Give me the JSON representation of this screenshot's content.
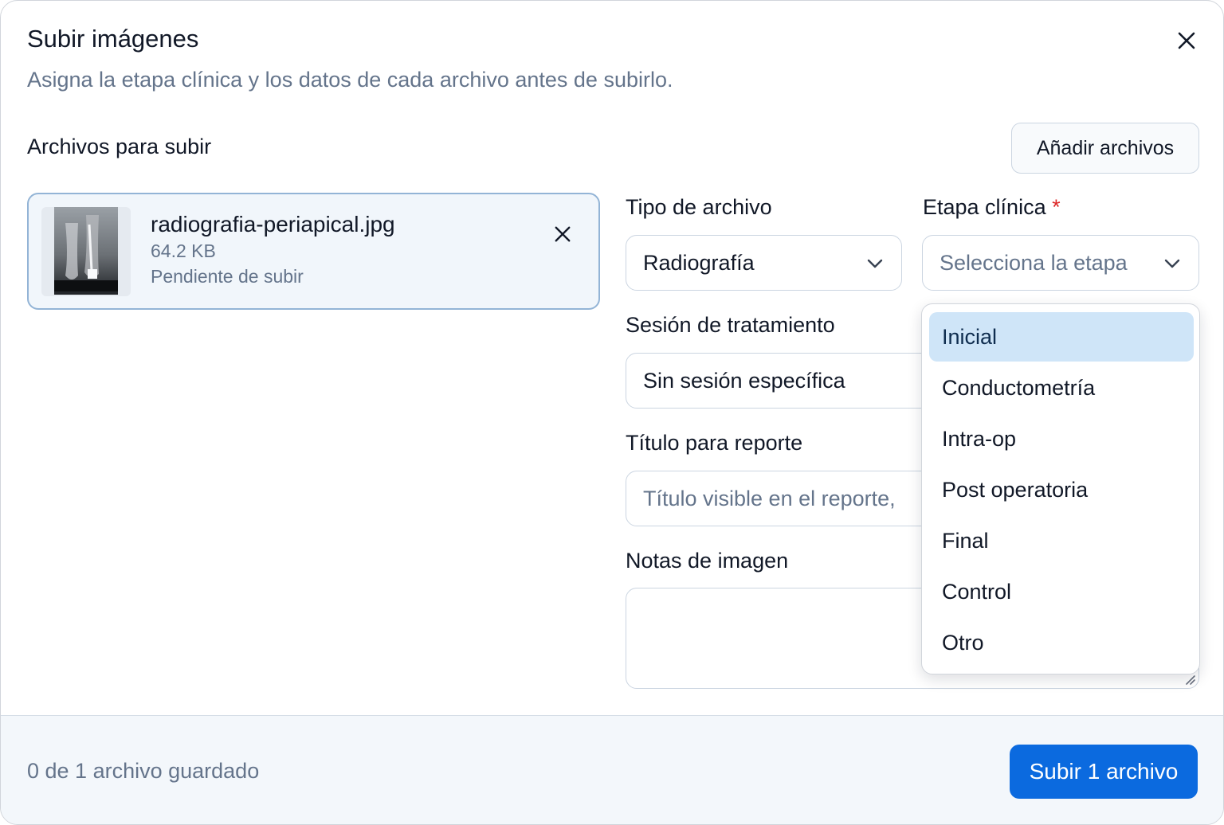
{
  "header": {
    "title": "Subir imágenes",
    "subtitle": "Asigna la etapa clínica y los datos de cada archivo antes de subirlo.",
    "close_icon": "close-icon"
  },
  "files_section": {
    "title": "Archivos para subir",
    "add_label": "Añadir archivos"
  },
  "file": {
    "name": "radiografia-periapical.jpg",
    "size": "64.2 KB",
    "status": "Pendiente de subir"
  },
  "form": {
    "file_type_label": "Tipo de archivo",
    "file_type_value": "Radiografía",
    "stage_label": "Etapa clínica",
    "stage_required_mark": "*",
    "stage_placeholder": "Selecciona la etapa",
    "session_label": "Sesión de tratamiento",
    "session_value": "Sin sesión específica",
    "report_title_label": "Título para reporte",
    "report_title_placeholder": "Título visible en el reporte,",
    "notes_label": "Notas de imagen"
  },
  "stage_options": [
    "Inicial",
    "Conductometría",
    "Intra-op",
    "Post operatoria",
    "Final",
    "Control",
    "Otro"
  ],
  "stage_active_index": 0,
  "footer": {
    "status": "0 de 1 archivo guardado",
    "upload_label": "Subir 1 archivo"
  },
  "colors": {
    "primary": "#0b6adf",
    "active_option": "#cfe5f8",
    "required": "#dc2626",
    "muted_text": "#64748b"
  }
}
